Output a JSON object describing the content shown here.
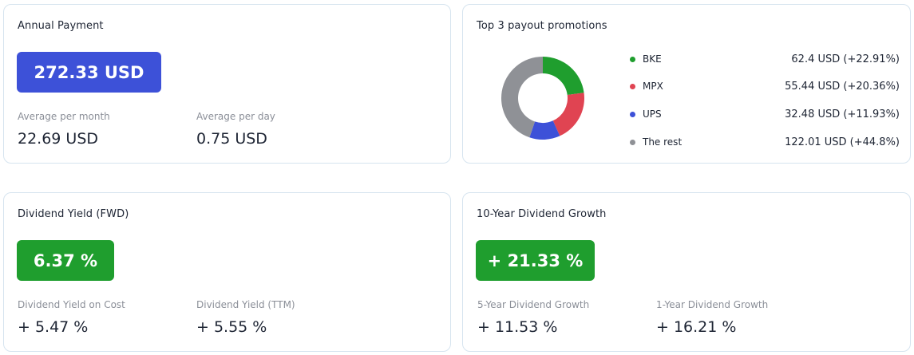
{
  "annual": {
    "title": "Annual Payment",
    "amount": "272.33 USD",
    "per_month_label": "Average per month",
    "per_month_value": "22.69 USD",
    "per_day_label": "Average per day",
    "per_day_value": "0.75 USD"
  },
  "payout": {
    "title": "Top 3 payout promotions",
    "items": [
      {
        "name": "BKE",
        "value": "62.4 USD (+22.91%)",
        "share": 22.91,
        "color": "#1f9e2e"
      },
      {
        "name": "MPX",
        "value": "55.44 USD (+20.36%)",
        "share": 20.36,
        "color": "#e04452"
      },
      {
        "name": "UPS",
        "value": "32.48 USD (+11.93%)",
        "share": 11.93,
        "color": "#3d51d8"
      },
      {
        "name": "The rest",
        "value": "122.01 USD (+44.8%)",
        "share": 44.8,
        "color": "#8f9196"
      }
    ]
  },
  "yield": {
    "title": "Dividend Yield (FWD)",
    "value": "6.37 %",
    "on_cost_label": "Dividend Yield on Cost",
    "on_cost_value": "+ 5.47 %",
    "ttm_label": "Dividend Yield (TTM)",
    "ttm_value": "+ 5.55 %"
  },
  "growth": {
    "title": "10-Year Dividend Growth",
    "value": "+ 21.33 %",
    "five_year_label": "5-Year Dividend Growth",
    "five_year_value": "+ 11.53 %",
    "one_year_label": "1-Year Dividend Growth",
    "one_year_value": "+ 16.21 %"
  }
}
